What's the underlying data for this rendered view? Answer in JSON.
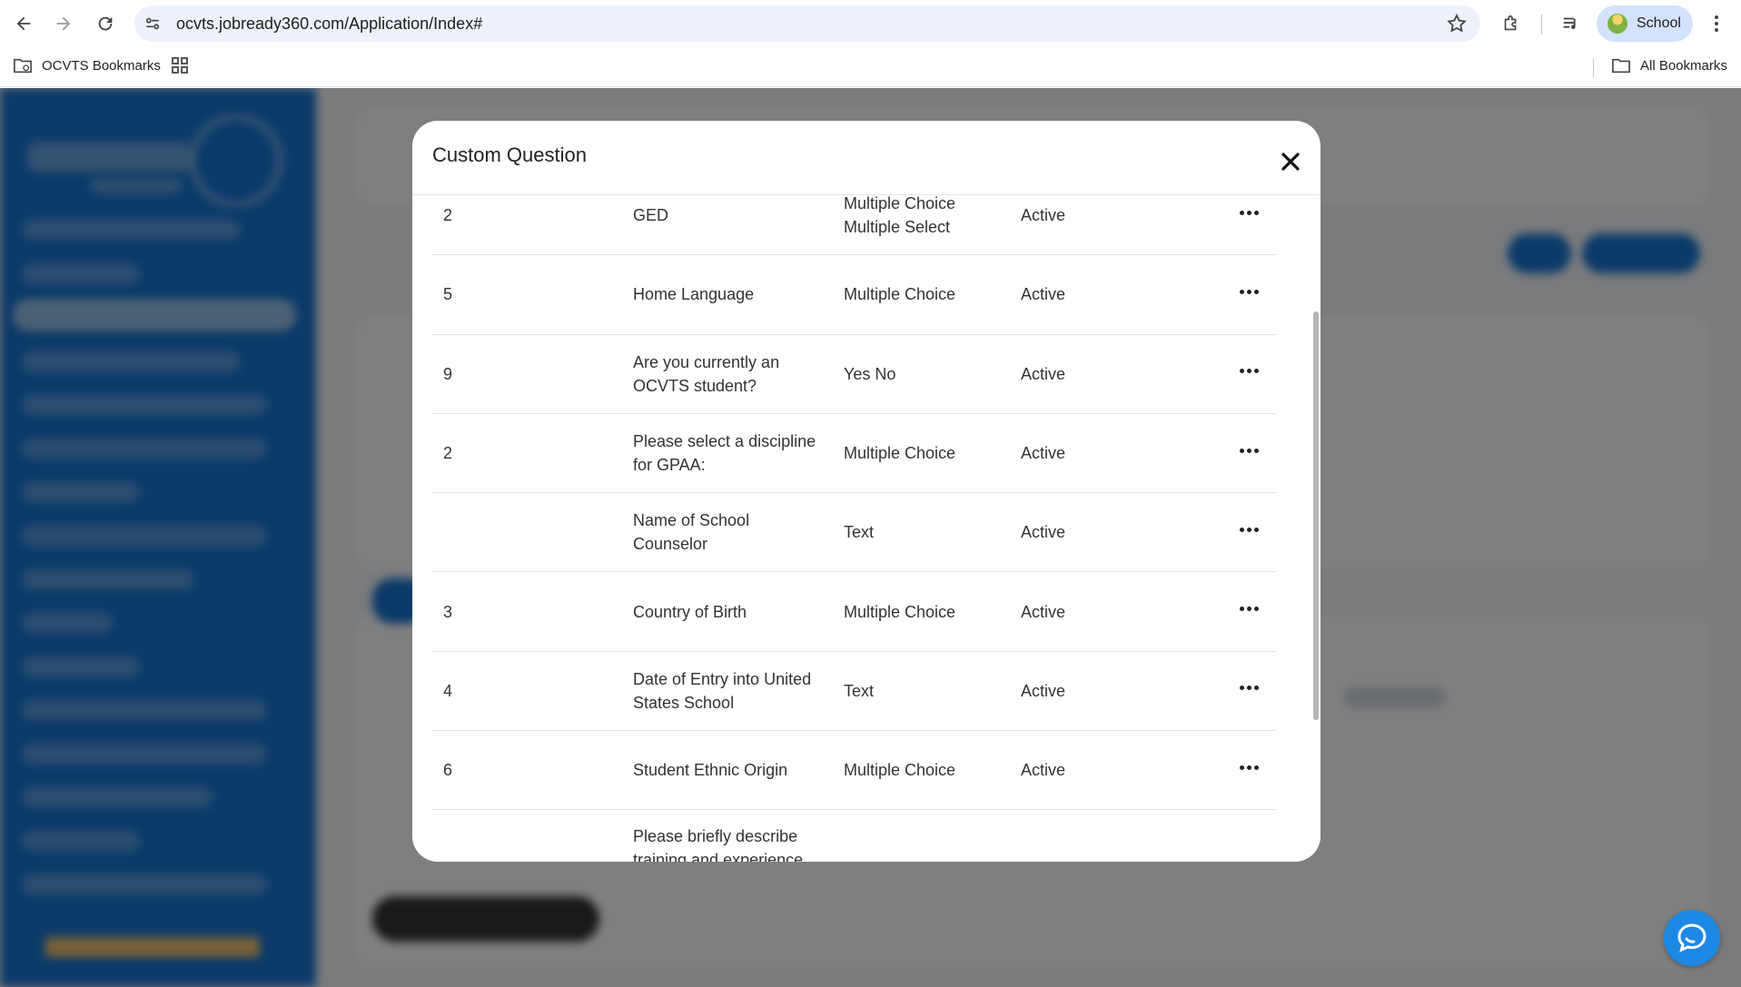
{
  "browser": {
    "url": "ocvts.jobready360.com/Application/Index#",
    "profile_name": "School",
    "bookmarks": [
      {
        "label": "OCVTS Bookmarks",
        "icon": "bookmark-folder-icon"
      },
      {
        "label": "",
        "icon": "apps-grid-icon"
      }
    ],
    "all_bookmarks_label": "All Bookmarks"
  },
  "modal": {
    "title": "Custom Question",
    "rows": [
      {
        "order": "2",
        "question": "GED",
        "type": "Multiple Choice Multiple Select",
        "status": "Active"
      },
      {
        "order": "5",
        "question": "Home Language",
        "type": "Multiple Choice",
        "status": "Active"
      },
      {
        "order": "9",
        "question": "Are you currently an OCVTS student?",
        "type": "Yes No",
        "status": "Active"
      },
      {
        "order": "2",
        "question": "Please select a discipline for GPAA:",
        "type": "Multiple Choice",
        "status": "Active"
      },
      {
        "order": "",
        "question": "Name of School Counselor",
        "type": "Text",
        "status": "Active"
      },
      {
        "order": "3",
        "question": "Country of Birth",
        "type": "Multiple Choice",
        "status": "Active"
      },
      {
        "order": "4",
        "question": "Date of Entry into United States School",
        "type": "Text",
        "status": "Active"
      },
      {
        "order": "6",
        "question": "Student Ethnic Origin",
        "type": "Multiple Choice",
        "status": "Active"
      },
      {
        "order": "",
        "question": "Please briefly describe training and experience",
        "type": "",
        "status": ""
      }
    ]
  },
  "colors": {
    "sidebar": "#1976d2",
    "overlay": "rgba(0,0,0,0.5)",
    "chat_button": "#1e88e5",
    "omnibox": "#edf2fa",
    "profile_chip": "#d3e3fd"
  }
}
